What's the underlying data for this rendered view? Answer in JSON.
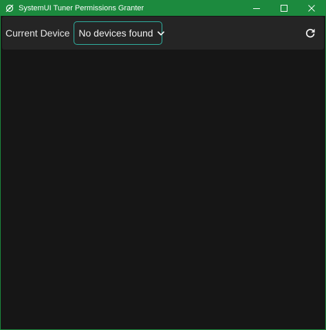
{
  "window": {
    "title": "SystemUI Tuner Permissions Granter",
    "accent_color": "#1c8a3e",
    "controls": {
      "minimize_icon": "minimize-icon",
      "maximize_icon": "maximize-icon",
      "close_icon": "close-icon"
    }
  },
  "toolbar": {
    "device_label": "Current Device",
    "device_select": {
      "selected": "No devices found",
      "border_color": "#2fb3a3"
    },
    "refresh_icon": "refresh-icon"
  }
}
